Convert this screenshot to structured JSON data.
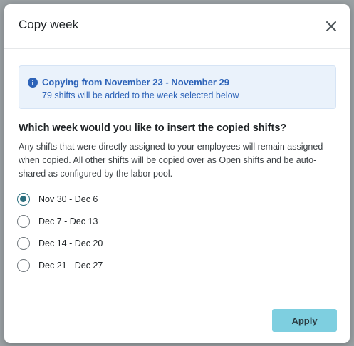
{
  "modal": {
    "title": "Copy week",
    "close_icon": "close-icon"
  },
  "info": {
    "icon": "info-icon",
    "title": "Copying from November 23 - November 29",
    "subtitle": "79 shifts will be added to the week selected below"
  },
  "question": "Which week would you like to insert the copied shifts?",
  "description": "Any shifts that were directly assigned to your employees will remain assigned when copied. All other shifts will be copied over as Open shifts and be auto-shared as configured by the labor pool.",
  "weeks": [
    {
      "label": "Nov 30 - Dec 6",
      "selected": true
    },
    {
      "label": "Dec 7 - Dec 13",
      "selected": false
    },
    {
      "label": "Dec 14 - Dec 20",
      "selected": false
    },
    {
      "label": "Dec 21 - Dec 27",
      "selected": false
    }
  ],
  "footer": {
    "apply_label": "Apply"
  },
  "colors": {
    "accent": "#2b6e7e",
    "apply_button": "#7ecfe0",
    "info_background": "#eaf2fb",
    "info_text": "#2d63b8"
  }
}
